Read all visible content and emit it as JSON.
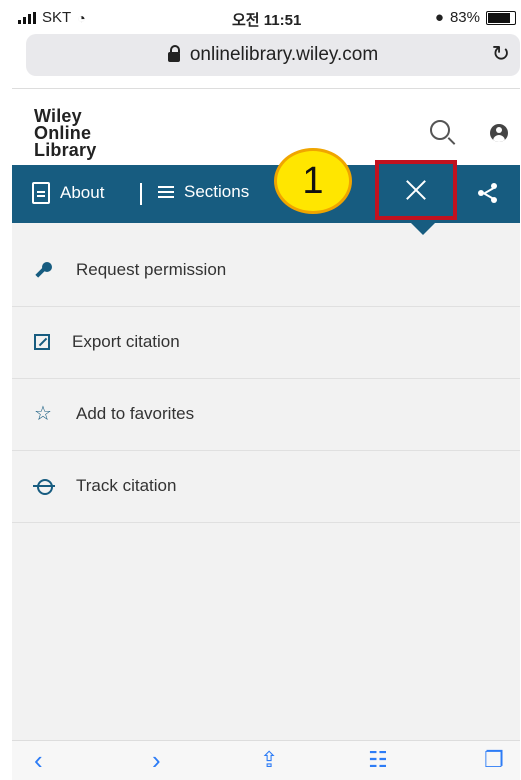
{
  "status_bar": {
    "carrier": "SKT",
    "time": "오전 11:51",
    "battery": "83%"
  },
  "browser": {
    "url": "onlinelibrary.wiley.com"
  },
  "header": {
    "logo_line1": "Wiley",
    "logo_line2": "Online",
    "logo_line3": "Library"
  },
  "navbar": {
    "about_label": "About",
    "sections_label": "Sections",
    "annotation_number": "1"
  },
  "menu": {
    "items": [
      {
        "label": "Request permission",
        "icon": "key-icon"
      },
      {
        "label": "Export citation",
        "icon": "external-link-icon"
      },
      {
        "label": "Add to favorites",
        "icon": "star-icon"
      },
      {
        "label": "Track citation",
        "icon": "target-icon"
      }
    ]
  },
  "toolbar": {
    "back": "‹",
    "forward": "›"
  },
  "colors": {
    "nav_bg": "#175c80",
    "highlight": "#c1121f",
    "badge": "#ffe600",
    "ios_blue": "#2d7cf6"
  }
}
